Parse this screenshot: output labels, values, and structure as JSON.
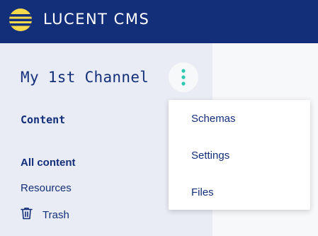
{
  "header": {
    "app_title": "LUCENT CMS",
    "logo_icon": "lucent-logo-icon",
    "brand_color": "#132f7a",
    "logo_color": "#f5d94a"
  },
  "sidebar": {
    "channel_title": "My 1st Channel",
    "kebab_icon": "vertical-ellipsis-icon",
    "kebab_color": "#2fc9b1",
    "section_label": "Content",
    "items": [
      {
        "label": "All content",
        "active": true
      },
      {
        "label": "Resources",
        "active": false
      },
      {
        "label": "Trash",
        "icon": "trash-icon",
        "active": false
      }
    ]
  },
  "channel_menu": {
    "items": [
      {
        "label": "Schemas"
      },
      {
        "label": "Settings"
      },
      {
        "label": "Files"
      }
    ]
  }
}
